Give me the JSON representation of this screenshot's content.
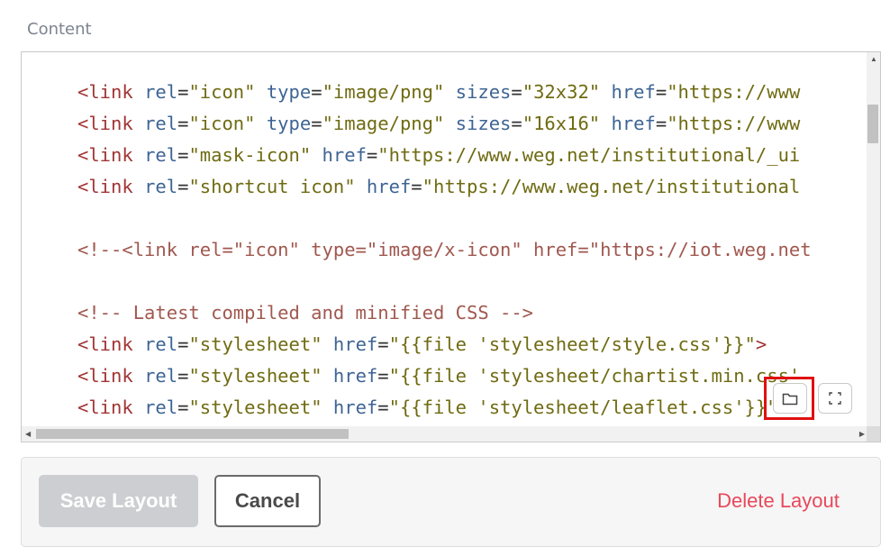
{
  "field_label": "Content",
  "code_lines": [
    [
      [
        "tag",
        "<link"
      ],
      [
        "sp",
        " "
      ],
      [
        "attr",
        "rel"
      ],
      [
        "eq",
        "="
      ],
      [
        "str",
        "\"icon\""
      ],
      [
        "sp",
        " "
      ],
      [
        "attr",
        "type"
      ],
      [
        "eq",
        "="
      ],
      [
        "str",
        "\"image/png\""
      ],
      [
        "sp",
        " "
      ],
      [
        "attr",
        "sizes"
      ],
      [
        "eq",
        "="
      ],
      [
        "str",
        "\"32x32\""
      ],
      [
        "sp",
        " "
      ],
      [
        "attr",
        "href"
      ],
      [
        "eq",
        "="
      ],
      [
        "str",
        "\"https://www"
      ]
    ],
    [
      [
        "tag",
        "<link"
      ],
      [
        "sp",
        " "
      ],
      [
        "attr",
        "rel"
      ],
      [
        "eq",
        "="
      ],
      [
        "str",
        "\"icon\""
      ],
      [
        "sp",
        " "
      ],
      [
        "attr",
        "type"
      ],
      [
        "eq",
        "="
      ],
      [
        "str",
        "\"image/png\""
      ],
      [
        "sp",
        " "
      ],
      [
        "attr",
        "sizes"
      ],
      [
        "eq",
        "="
      ],
      [
        "str",
        "\"16x16\""
      ],
      [
        "sp",
        " "
      ],
      [
        "attr",
        "href"
      ],
      [
        "eq",
        "="
      ],
      [
        "str",
        "\"https://www"
      ]
    ],
    [
      [
        "tag",
        "<link"
      ],
      [
        "sp",
        " "
      ],
      [
        "attr",
        "rel"
      ],
      [
        "eq",
        "="
      ],
      [
        "str",
        "\"mask-icon\""
      ],
      [
        "sp",
        " "
      ],
      [
        "attr",
        "href"
      ],
      [
        "eq",
        "="
      ],
      [
        "str",
        "\"https://www.weg.net/institutional/_ui"
      ]
    ],
    [
      [
        "tag",
        "<link"
      ],
      [
        "sp",
        " "
      ],
      [
        "attr",
        "rel"
      ],
      [
        "eq",
        "="
      ],
      [
        "str",
        "\"shortcut icon\""
      ],
      [
        "sp",
        " "
      ],
      [
        "attr",
        "href"
      ],
      [
        "eq",
        "="
      ],
      [
        "str",
        "\"https://www.weg.net/institutional"
      ]
    ],
    [],
    [
      [
        "cmt",
        "<!--<link rel=\"icon\" type=\"image/x-icon\" href=\"https://iot.weg.net"
      ]
    ],
    [],
    [
      [
        "cmt",
        "<!-- Latest compiled and minified CSS -->"
      ]
    ],
    [
      [
        "tag",
        "<link"
      ],
      [
        "sp",
        " "
      ],
      [
        "attr",
        "rel"
      ],
      [
        "eq",
        "="
      ],
      [
        "str",
        "\"stylesheet\""
      ],
      [
        "sp",
        " "
      ],
      [
        "attr",
        "href"
      ],
      [
        "eq",
        "="
      ],
      [
        "str",
        "\"{{file 'stylesheet/style.css'}}\""
      ],
      [
        "tag",
        ">"
      ]
    ],
    [
      [
        "tag",
        "<link"
      ],
      [
        "sp",
        " "
      ],
      [
        "attr",
        "rel"
      ],
      [
        "eq",
        "="
      ],
      [
        "str",
        "\"stylesheet\""
      ],
      [
        "sp",
        " "
      ],
      [
        "attr",
        "href"
      ],
      [
        "eq",
        "="
      ],
      [
        "str",
        "\"{{file 'stylesheet/chartist.min.css'"
      ]
    ],
    [
      [
        "tag",
        "<link"
      ],
      [
        "sp",
        " "
      ],
      [
        "attr",
        "rel"
      ],
      [
        "eq",
        "="
      ],
      [
        "str",
        "\"stylesheet\""
      ],
      [
        "sp",
        " "
      ],
      [
        "attr",
        "href"
      ],
      [
        "eq",
        "="
      ],
      [
        "str",
        "\"{{file 'stylesheet/leaflet.css'}}\""
      ],
      [
        "tag",
        ">"
      ]
    ]
  ],
  "toolbar": {
    "browse_icon": "folder-icon",
    "fullscreen_icon": "fullscreen-icon"
  },
  "footer": {
    "save_label": "Save Layout",
    "cancel_label": "Cancel",
    "delete_label": "Delete Layout"
  },
  "colors": {
    "tag": "#a23535",
    "attribute": "#3e6494",
    "string": "#6f6b12",
    "comment": "#a0584f",
    "delete": "#e8485a",
    "highlight": "#e01010"
  }
}
